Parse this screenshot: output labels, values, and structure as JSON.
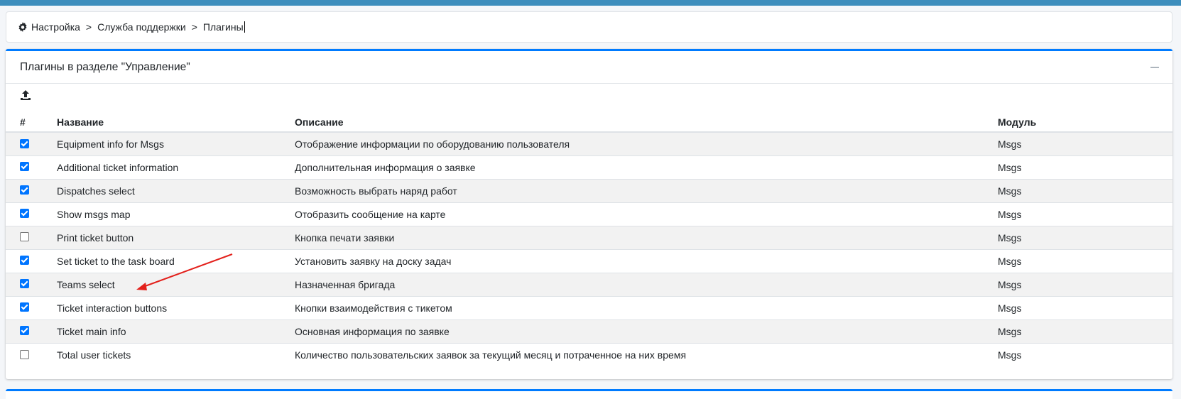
{
  "breadcrumb": {
    "items": [
      "Настройка",
      "Служба поддержки",
      "Плагины"
    ],
    "separator": ">"
  },
  "panel": {
    "title": "Плагины в разделе \"Управление\"",
    "accent_color": "#007bff"
  },
  "table": {
    "columns": [
      "#",
      "Название",
      "Описание",
      "Модуль"
    ],
    "rows": [
      {
        "checked": true,
        "name": "Equipment info for Msgs",
        "description": "Отображение информации по оборудованию пользователя",
        "module": "Msgs"
      },
      {
        "checked": true,
        "name": "Additional ticket information",
        "description": "Дополнительная информация о заявке",
        "module": "Msgs"
      },
      {
        "checked": true,
        "name": "Dispatches select",
        "description": "Возможность выбрать наряд работ",
        "module": "Msgs"
      },
      {
        "checked": true,
        "name": "Show msgs map",
        "description": "Отобразить сообщение на карте",
        "module": "Msgs"
      },
      {
        "checked": false,
        "name": "Print ticket button",
        "description": "Кнопка печати заявки",
        "module": "Msgs"
      },
      {
        "checked": true,
        "name": "Set ticket to the task board",
        "description": "Установить заявку на доску задач",
        "module": "Msgs"
      },
      {
        "checked": true,
        "name": "Teams select",
        "description": "Назначенная бригада",
        "module": "Msgs"
      },
      {
        "checked": true,
        "name": "Ticket interaction buttons",
        "description": "Кнопки взаимодействия с тикетом",
        "module": "Msgs"
      },
      {
        "checked": true,
        "name": "Ticket main info",
        "description": "Основная информация по заявке",
        "module": "Msgs"
      },
      {
        "checked": false,
        "name": "Total user tickets",
        "description": "Количество пользовательских заявок за текущий месяц и потраченное на них время",
        "module": "Msgs"
      }
    ]
  },
  "icons": {
    "breadcrumb": "gear-icon",
    "toolbar": "upload-icon",
    "collapse": "minus-icon"
  },
  "annotation": {
    "color": "#e3201b",
    "points_to": "Teams select"
  }
}
